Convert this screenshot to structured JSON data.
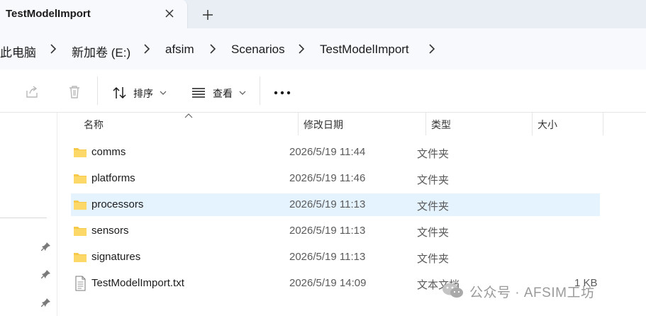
{
  "window": {
    "tab_title": "TestModelImport"
  },
  "address": {
    "crumbs": [
      "此电脑",
      "新加卷 (E:)",
      "afsim",
      "Scenarios",
      "TestModelImport"
    ]
  },
  "toolbar": {
    "sort_label": "排序",
    "view_label": "查看"
  },
  "columns": {
    "name": "名称",
    "date": "修改日期",
    "type": "类型",
    "size": "大小"
  },
  "files": [
    {
      "name": "comms",
      "date": "2026/5/19 11:44",
      "type": "文件夹",
      "size": "",
      "icon": "folder-icon"
    },
    {
      "name": "platforms",
      "date": "2026/5/19 11:46",
      "type": "文件夹",
      "size": "",
      "icon": "folder-icon"
    },
    {
      "name": "processors",
      "date": "2026/5/19 11:13",
      "type": "文件夹",
      "size": "",
      "icon": "folder-icon",
      "selected": true
    },
    {
      "name": "sensors",
      "date": "2026/5/19 11:13",
      "type": "文件夹",
      "size": "",
      "icon": "folder-icon"
    },
    {
      "name": "signatures",
      "date": "2026/5/19 11:13",
      "type": "文件夹",
      "size": "",
      "icon": "folder-icon"
    },
    {
      "name": "TestModelImport.txt",
      "date": "2026/5/19 14:09",
      "type": "文本文档",
      "size": "1 KB",
      "icon": "text-file-icon"
    }
  ],
  "watermark": {
    "text": "公众号 · AFSIM工坊"
  },
  "colors": {
    "folder": "#f7c948",
    "selection": "#e5f3ff",
    "tabstrip": "#e9eef5"
  }
}
